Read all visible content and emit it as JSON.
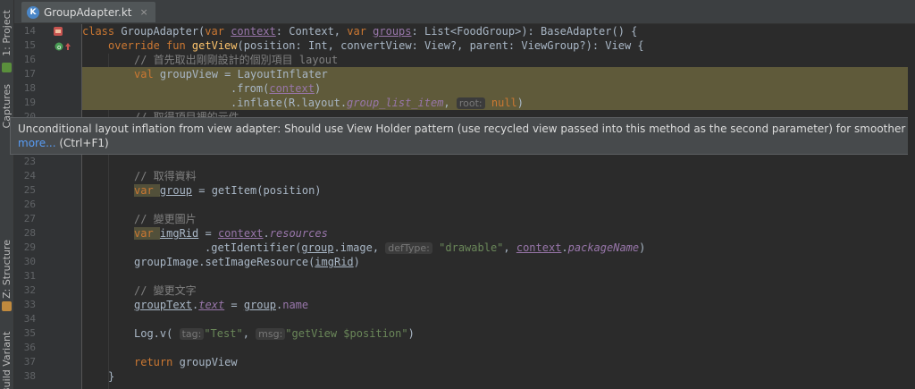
{
  "tool_strip": {
    "tabs": [
      "1: Project",
      "Captures",
      "Z: Structure",
      "Build Variants"
    ]
  },
  "editor_tab": {
    "filename": "GroupAdapter.kt",
    "icon": "kotlin-file-icon",
    "close": "×"
  },
  "tooltip": {
    "message": "Unconditional layout inflation from view adapter: Should use View Holder pattern (use recycled view passed into this method as the second parameter) for smoother scrolling",
    "more_link": "more...",
    "shortcut": "(Ctrl+F1)"
  },
  "line_numbers": [
    "14",
    "15",
    "16",
    "17",
    "18",
    "19",
    "20",
    "23",
    "24",
    "25",
    "26",
    "27",
    "28",
    "29",
    "30",
    "31",
    "32",
    "33",
    "34",
    "35",
    "36",
    "37",
    "38"
  ],
  "code": {
    "l14": {
      "kw1": "class ",
      "cls": "GroupAdapter(",
      "kw2": "var ",
      "p1": "context",
      "t1": ": Context, ",
      "kw3": "var ",
      "p2": "groups",
      "t2": ": List<FoodGroup>): BaseAdapter() {"
    },
    "l15": {
      "kw1": "override fun ",
      "fn": "getView",
      "rest": "(position: Int, convertView: View?, parent: ViewGroup?): View {"
    },
    "l16": {
      "comment": "// 首先取出剛剛設計的個別項目 layout"
    },
    "l17": {
      "kw": "val ",
      "rest": "groupView = LayoutInflater"
    },
    "l18": {
      "a": ".from(",
      "p": "context",
      "b": ")"
    },
    "l19": {
      "a": ".inflate(R.layout.",
      "p": "group_list_item",
      "b": ", ",
      "hint": "root:",
      "kw": "null",
      "c": ")"
    },
    "l20": {
      "comment": "// 取得項目裡的元件"
    },
    "l24": {
      "comment": "// 取得資料"
    },
    "l25": {
      "kw": "var ",
      "v": "group",
      "rest": " = getItem(position)"
    },
    "l27": {
      "comment": "// 變更圖片"
    },
    "l28": {
      "kw": "var ",
      "v": "imgRid",
      "a": " = ",
      "p": "context",
      "b": ".",
      "prop": "resources"
    },
    "l29": {
      "a": ".getIdentifier(",
      "v": "group",
      "b": ".image, ",
      "hint": "defType:",
      "str": "\"drawable\"",
      "c": ", ",
      "p": "context",
      "d": ".",
      "prop": "packageName",
      "e": ")"
    },
    "l30": {
      "a": "groupImage",
      "b": ".setImageResource(",
      "v": "imgRid",
      "c": ")"
    },
    "l32": {
      "comment": "// 變更文字"
    },
    "l33": {
      "a": "groupText",
      "b": ".",
      "prop": "text",
      "c": " = ",
      "v": "group",
      "d": ".",
      "prop2": "name"
    },
    "l35": {
      "a": "Log.v( ",
      "hint1": "tag:",
      "s1": "\"Test\"",
      "b": ", ",
      "hint2": "msg:",
      "s2": "\"getView $position\"",
      "c": ")"
    },
    "l37": {
      "kw": "return ",
      "rest": "groupView"
    },
    "l38": {
      "rest": "}"
    }
  }
}
